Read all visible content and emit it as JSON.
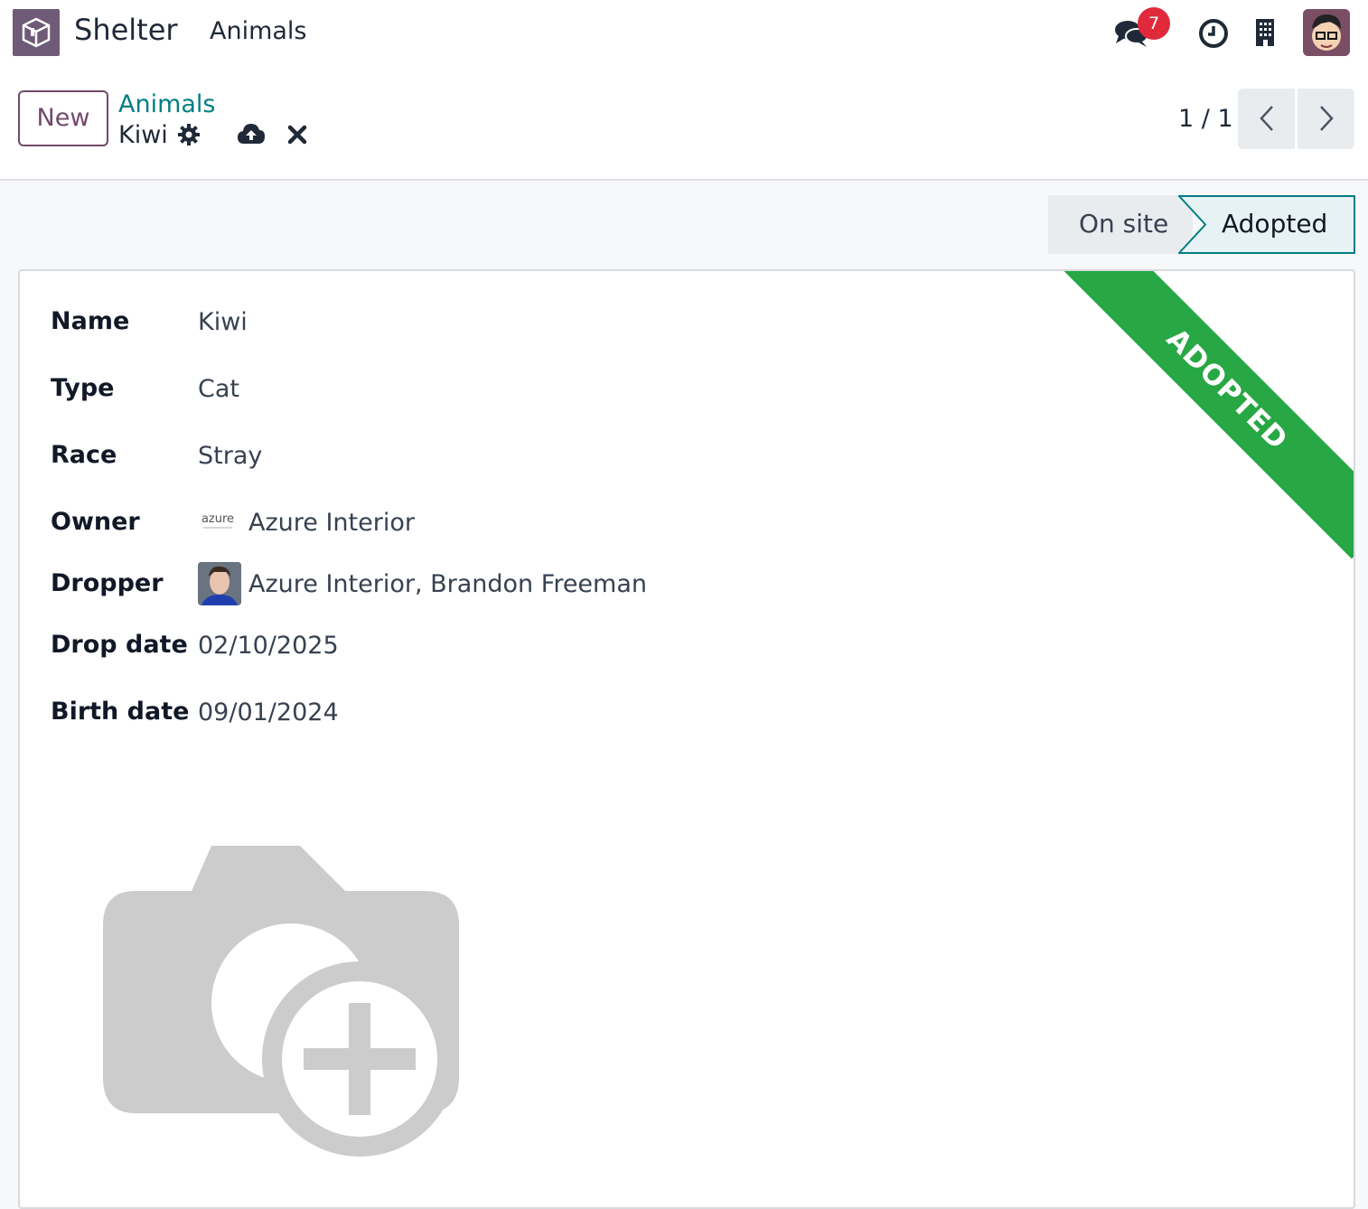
{
  "navbar": {
    "app_name": "Shelter",
    "menu_item": "Animals",
    "messages_badge": "7",
    "icons": [
      "app-logo-icon",
      "chat-icon",
      "clock-icon",
      "company-building-icon",
      "user-avatar"
    ]
  },
  "control_panel": {
    "new_label": "New",
    "breadcrumb_parent": "Animals",
    "record_name": "Kiwi",
    "pager_value": "1 / 1",
    "icons": [
      "gear-icon",
      "cloud-upload-icon",
      "close-icon",
      "chevron-left-icon",
      "chevron-right-icon"
    ]
  },
  "status_bar": {
    "stages": [
      "On site",
      "Adopted"
    ],
    "current": "Adopted"
  },
  "ribbon": {
    "text": "ADOPTED",
    "color": "#28a745"
  },
  "fields": {
    "name": {
      "label": "Name",
      "value": "Kiwi"
    },
    "type": {
      "label": "Type",
      "value": "Cat"
    },
    "race": {
      "label": "Race",
      "value": "Stray"
    },
    "owner": {
      "label": "Owner",
      "value": "Azure Interior"
    },
    "dropper": {
      "label": "Dropper",
      "value": "Azure Interior, Brandon Freeman"
    },
    "drop_date": {
      "label": "Drop date",
      "value": "02/10/2025"
    },
    "birth_date": {
      "label": "Birth date",
      "value": "09/01/2024"
    }
  },
  "owner_logo_text": "azure",
  "image_field": {
    "icon": "camera-add-icon"
  },
  "colors": {
    "brand": "#71496b",
    "link": "#017e84",
    "badge": "#e02a3b",
    "ribbon": "#28a745"
  }
}
